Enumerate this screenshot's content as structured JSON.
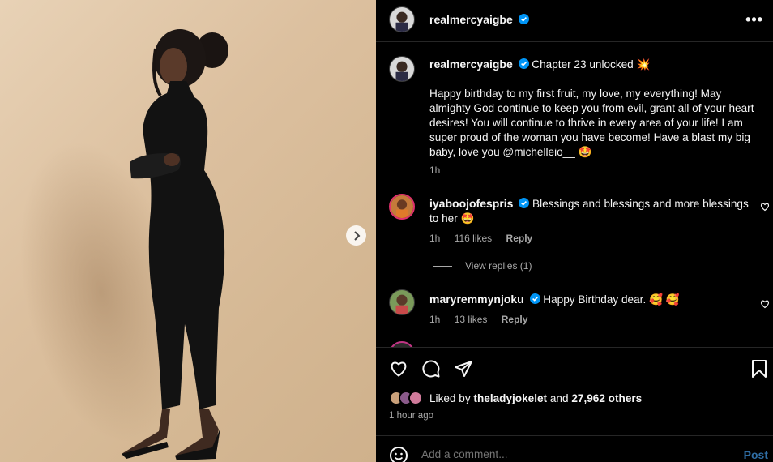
{
  "post": {
    "author": "realmercyaigbe",
    "verified": true,
    "caption_title": "Chapter 23 unlocked 💥",
    "caption_body": "Happy birthday to my first fruit, my love, my everything! May almighty God continue to keep you from evil, grant all of your heart desires! You will continue to thrive in every area of your life! I am super proud of the woman you have become! Have a blast my big baby, love you @michelleio__ 🤩",
    "caption_time": "1h"
  },
  "comments": [
    {
      "user": "iyaboojofespris",
      "verified": true,
      "text": "Blessings and blessings and more blessings to her 🤩",
      "time": "1h",
      "likes": "116 likes",
      "reply": "Reply"
    },
    {
      "user": "maryremmynjoku",
      "verified": true,
      "text": "Happy Birthday dear. 🥰 🥰",
      "time": "1h",
      "likes": "13 likes",
      "reply": "Reply"
    }
  ],
  "view_replies": "View replies (1)",
  "likes_bar": {
    "prefix": "Liked by",
    "liker": "theladyjokelet",
    "middle": "and",
    "others": "27,962 others"
  },
  "posted_time": "1 hour ago",
  "add_comment": {
    "placeholder": "Add a comment...",
    "post_label": "Post"
  },
  "icons": [
    "more-options-icon",
    "heart-icon",
    "comment-icon",
    "share-icon",
    "bookmark-icon",
    "emoji-icon",
    "verified-icon",
    "next-arrow-icon"
  ],
  "colors": {
    "background": "#000000",
    "verified": "#0095f6",
    "post_link": "#2f6da3",
    "muted": "#a8a8a8"
  }
}
